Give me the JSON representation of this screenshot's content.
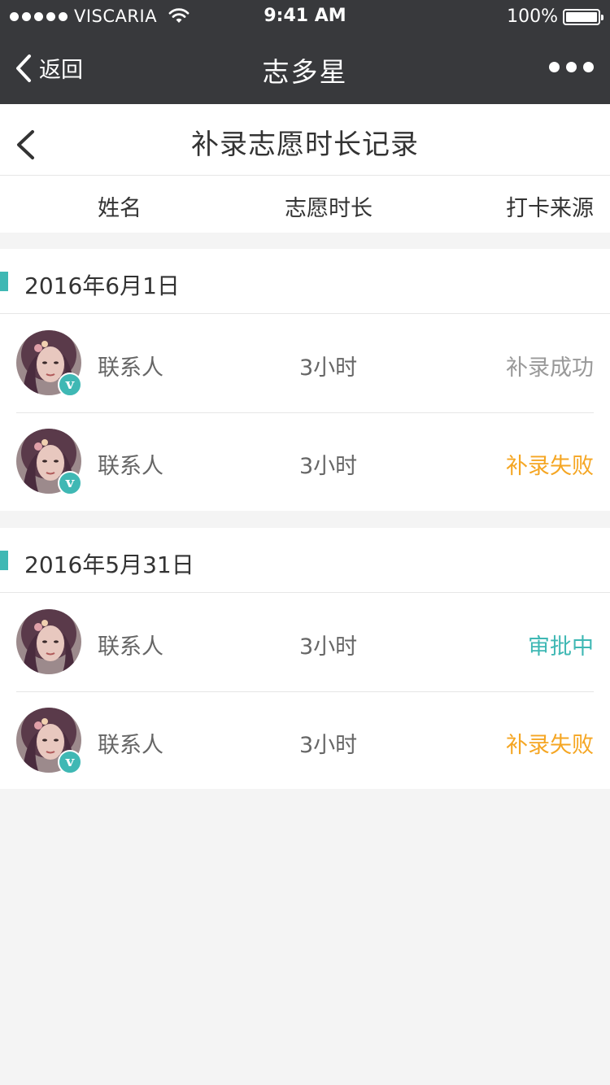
{
  "status_bar": {
    "carrier": "VISCARIA",
    "time": "9:41 AM",
    "battery": "100%"
  },
  "nav": {
    "back_label": "返回",
    "title": "志多星"
  },
  "page": {
    "title": "补录志愿时长记录"
  },
  "columns": {
    "name": "姓名",
    "hours": "志愿时长",
    "source": "打卡来源"
  },
  "groups": [
    {
      "date": "2016年6月1日",
      "records": [
        {
          "name": "联系人",
          "hours": "3小时",
          "status": "补录成功",
          "status_color": "#999999",
          "verified": true,
          "badge": "v"
        },
        {
          "name": "联系人",
          "hours": "3小时",
          "status": "补录失败",
          "status_color": "#f5a623",
          "verified": true,
          "badge": "v"
        }
      ]
    },
    {
      "date": "2016年5月31日",
      "records": [
        {
          "name": "联系人",
          "hours": "3小时",
          "status": "审批中",
          "status_color": "#3fb8b4",
          "verified": false
        },
        {
          "name": "联系人",
          "hours": "3小时",
          "status": "补录失败",
          "status_color": "#f5a623",
          "verified": true,
          "badge": "v"
        }
      ]
    }
  ],
  "colors": {
    "nav_background": "#38393c",
    "accent": "#3fb8b4",
    "failed": "#f5a623",
    "success": "#999999"
  }
}
